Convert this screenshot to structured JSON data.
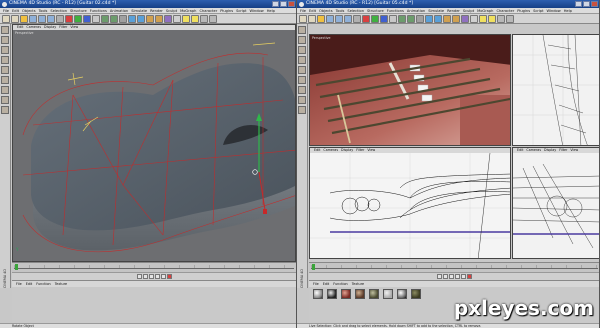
{
  "left_window": {
    "title": "CINEMA 4D Studio (RC - R12) [Guitar 02.c4d *]",
    "menu": [
      "File",
      "Edit",
      "Objects",
      "Tools",
      "Selection",
      "Structure",
      "Functions",
      "Animation",
      "Simulate",
      "Render",
      "Sculpt",
      "MoGraph",
      "Character",
      "Plugins",
      "Script",
      "Window",
      "Help"
    ],
    "viewport_menu": [
      "Edit",
      "Cameras",
      "Display",
      "Filter",
      "View"
    ],
    "viewport_label": "Perspective",
    "sidebar_label": "CINEMA 4D",
    "material_menu": [
      "File",
      "Edit",
      "Function",
      "Texture"
    ],
    "status": "Rotate Object"
  },
  "right_window": {
    "title": "CINEMA 4D Studio (RC - R12) [Guitar 05.c4d *]",
    "menu": [
      "File",
      "Edit",
      "Objects",
      "Tools",
      "Selection",
      "Structure",
      "Functions",
      "Animation",
      "Simulate",
      "Render",
      "Sculpt",
      "MoGraph",
      "Character",
      "Plugins",
      "Script",
      "Window",
      "Help"
    ],
    "viewport_menu": [
      "Edit",
      "Cameras",
      "Display",
      "Filter",
      "View"
    ],
    "viewport_label": "Perspective",
    "sidebar_label": "CINEMA 4D",
    "material_menu": [
      "File",
      "Edit",
      "Function",
      "Texture"
    ],
    "status": "Live Selection: Click and drag to select elements. Hold down SHIFT to add to the selection, CTRL to remove."
  },
  "watermark": "pxleyes.com",
  "colors": {
    "titlebar": "#1d4a96",
    "viewport": "#6d6e71",
    "wireframe_red": "#c82828",
    "axis_green": "#2fb84a"
  }
}
